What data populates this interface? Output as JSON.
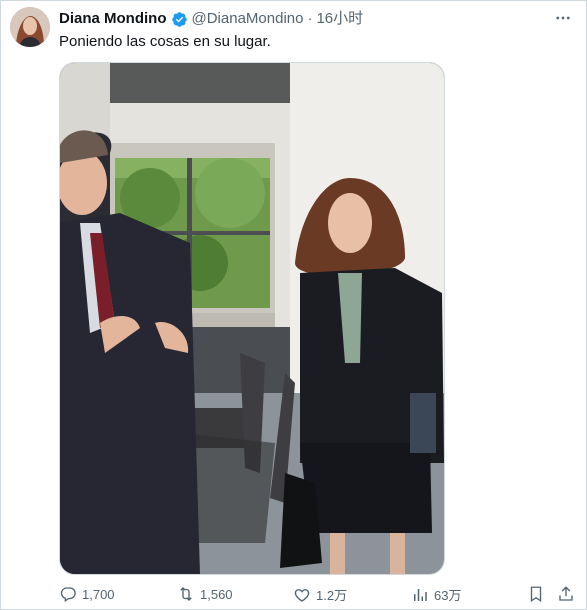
{
  "tweet": {
    "display_name": "Diana Mondino",
    "handle": "@DianaMondino",
    "separator": "·",
    "time": "16小时",
    "text": "Poniendo las cosas en su lugar.",
    "verified": true,
    "more_icon": "more-icon"
  },
  "actions": {
    "replies": "1,700",
    "reposts": "1,560",
    "likes": "1.2万",
    "views": "63万",
    "icons": [
      "reply-icon",
      "repost-icon",
      "like-icon",
      "views-icon",
      "bookmark-icon",
      "share-icon"
    ]
  },
  "colors": {
    "text": "#0f1419",
    "secondary": "#536471",
    "verified_blue": "#1d9bf0",
    "border": "#cfd9de"
  }
}
